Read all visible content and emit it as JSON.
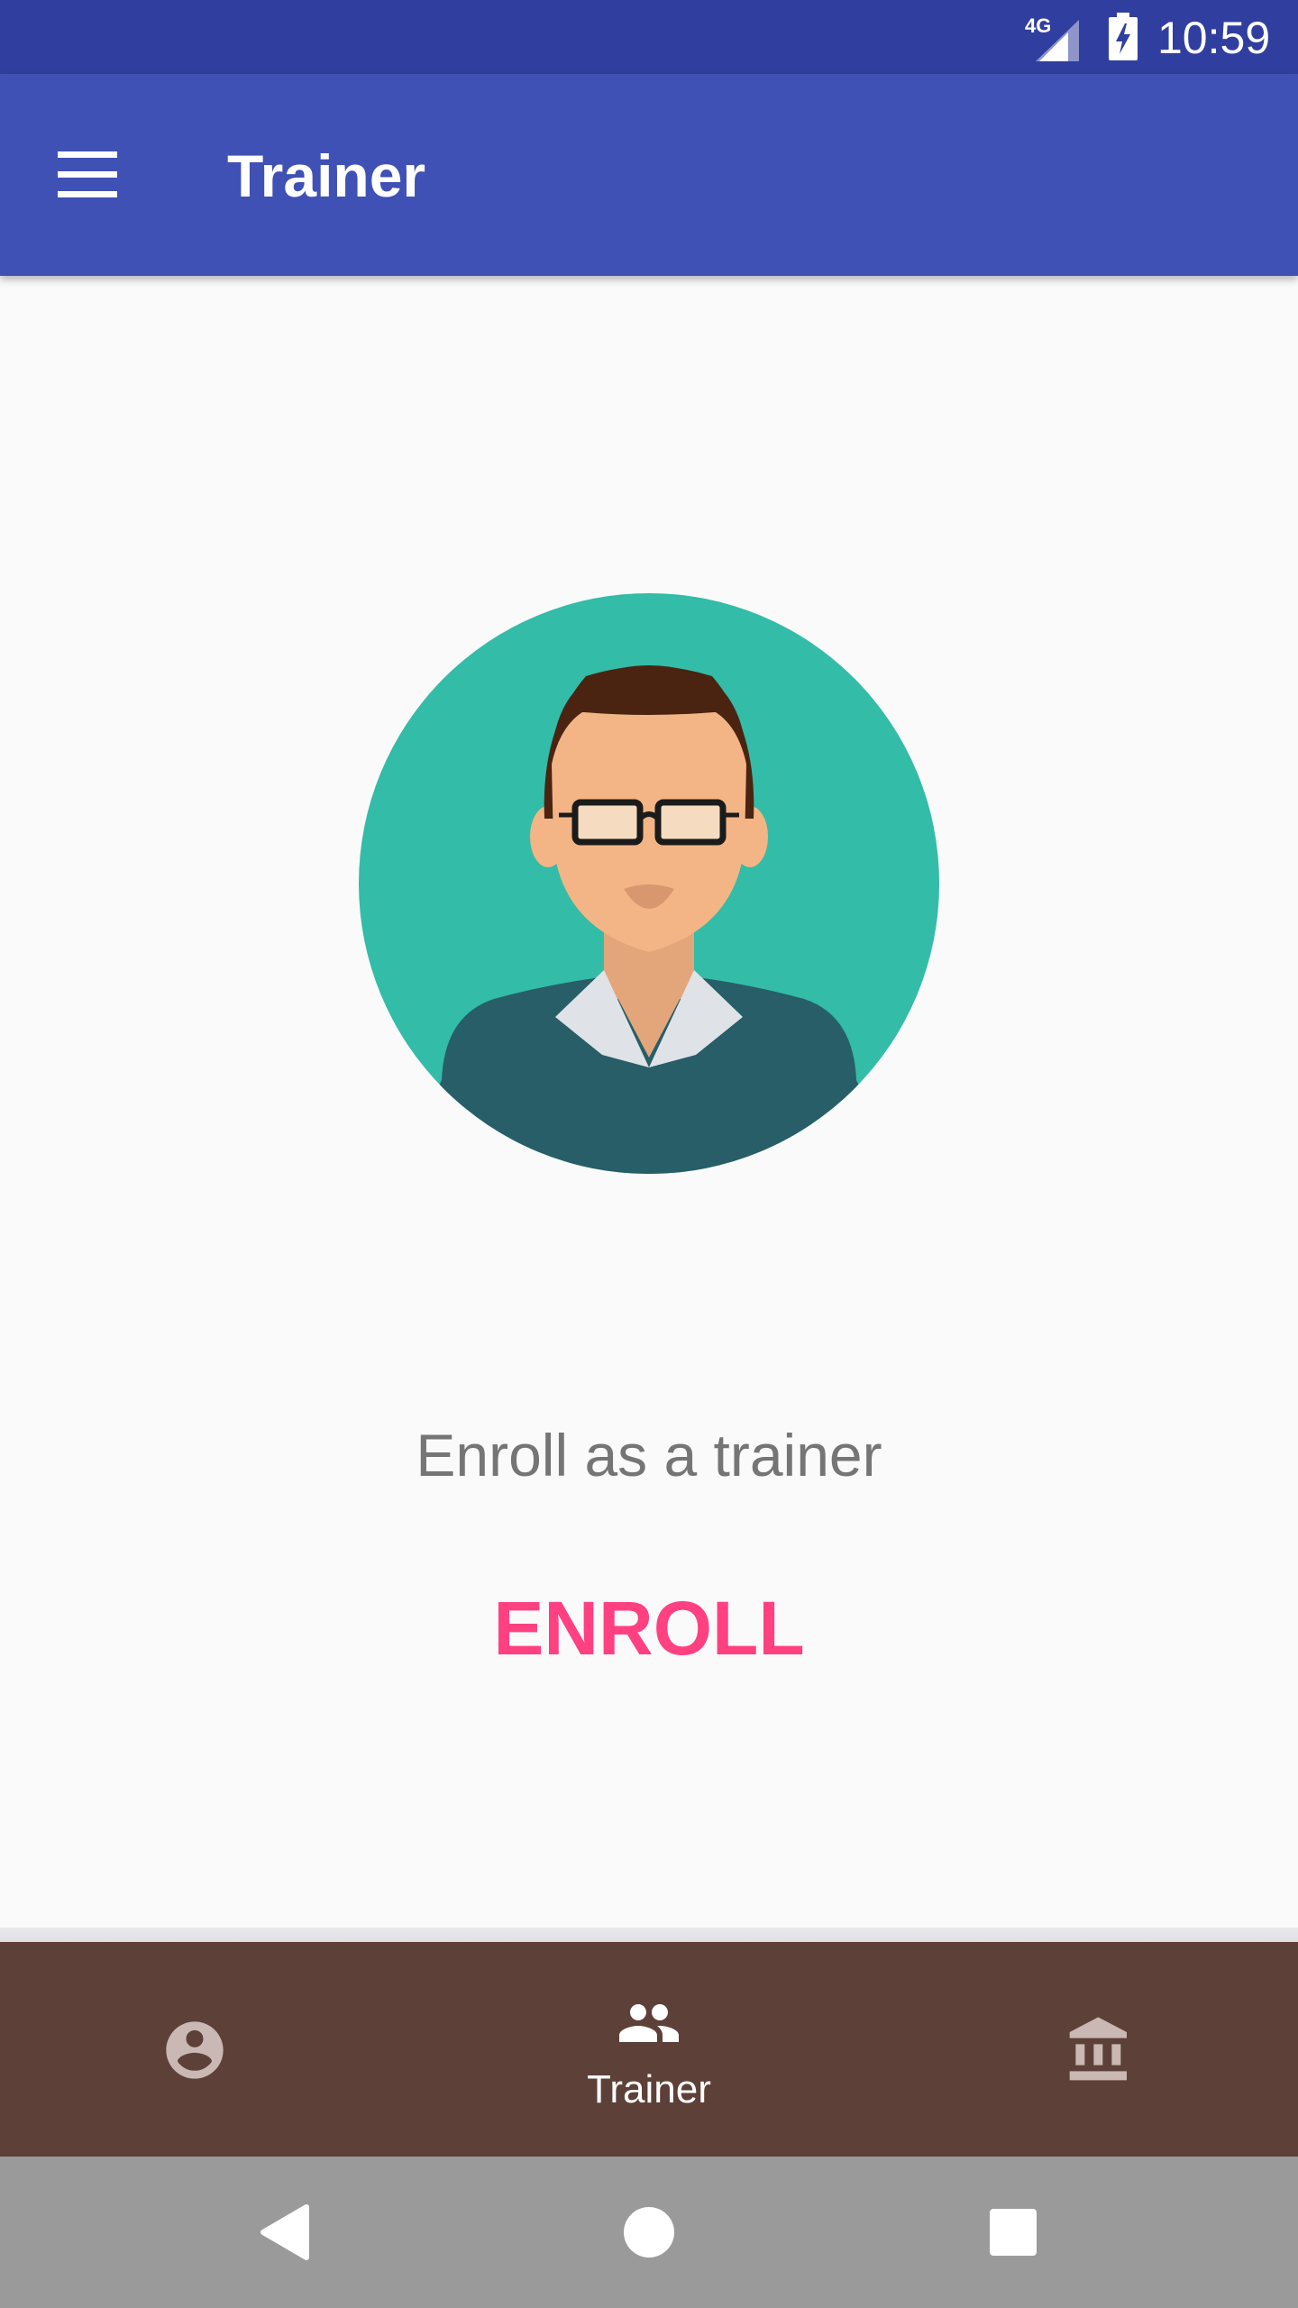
{
  "status_bar": {
    "network": "4G",
    "time": "10:59"
  },
  "app_bar": {
    "title": "Trainer",
    "menu_icon": "hamburger-menu-icon"
  },
  "content": {
    "avatar_icon": "trainer-avatar-illustration",
    "enroll_prompt": "Enroll as a trainer",
    "enroll_button": "ENROLL"
  },
  "bottom_nav": {
    "items": [
      {
        "icon": "account-circle-icon",
        "label": "",
        "active": false
      },
      {
        "icon": "people-icon",
        "label": "Trainer",
        "active": true
      },
      {
        "icon": "institution-icon",
        "label": "",
        "active": false
      }
    ]
  },
  "system_nav": {
    "buttons": [
      "back-icon",
      "home-icon",
      "recents-icon"
    ]
  },
  "colors": {
    "status_bar": "#303f9f",
    "primary": "#3f51b5",
    "accent": "#ff4081",
    "bottom_nav": "#5d4037",
    "system_nav": "#9a9a9a",
    "background": "#fafafa"
  }
}
